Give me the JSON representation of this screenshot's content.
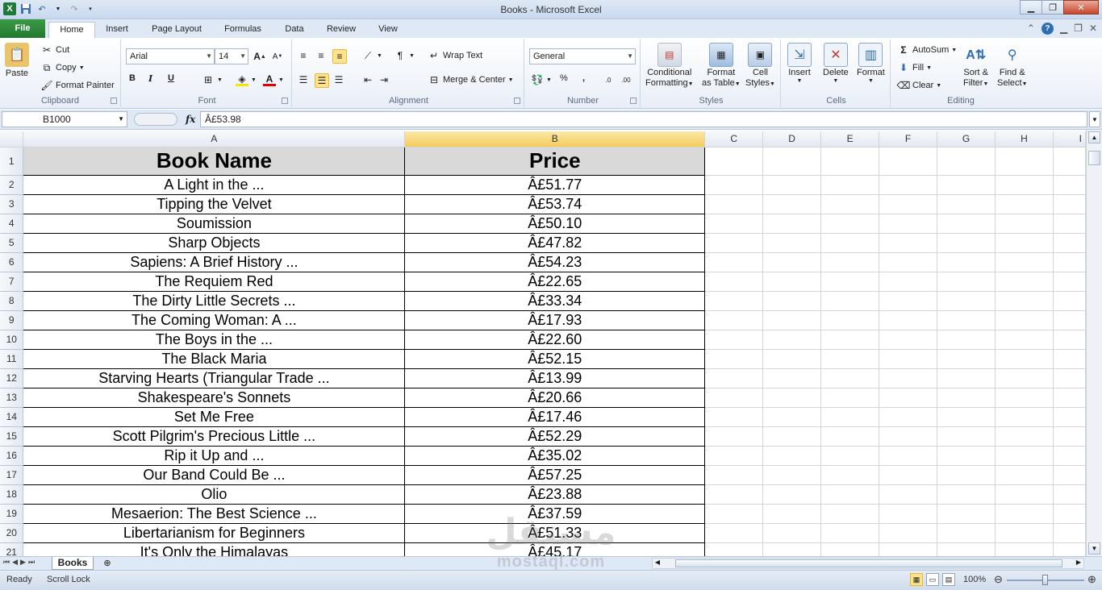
{
  "window": {
    "title": "Books - Microsoft Excel"
  },
  "ribbon": {
    "tabs": [
      "File",
      "Home",
      "Insert",
      "Page Layout",
      "Formulas",
      "Data",
      "Review",
      "View"
    ],
    "active_tab": "Home",
    "clipboard": {
      "paste": "Paste",
      "cut": "Cut",
      "copy": "Copy",
      "format_painter": "Format Painter",
      "label": "Clipboard"
    },
    "font": {
      "name": "Arial",
      "size": "14",
      "label": "Font",
      "bold": "B",
      "italic": "I",
      "underline": "U"
    },
    "alignment": {
      "wrap_text": "Wrap Text",
      "merge_center": "Merge & Center",
      "label": "Alignment"
    },
    "number": {
      "format": "General",
      "percent": "%",
      "comma": ",",
      "label": "Number"
    },
    "styles": {
      "conditional_formatting": [
        "Conditional",
        "Formatting"
      ],
      "format_as_table": [
        "Format",
        "as Table"
      ],
      "cell_styles": [
        "Cell",
        "Styles"
      ],
      "label": "Styles"
    },
    "cells": {
      "insert": "Insert",
      "delete": "Delete",
      "format": "Format",
      "label": "Cells"
    },
    "editing": {
      "autosum": "AutoSum",
      "fill": "Fill",
      "clear": "Clear",
      "sort_filter": [
        "Sort &",
        "Filter"
      ],
      "find_select": [
        "Find &",
        "Select"
      ],
      "label": "Editing"
    }
  },
  "formula_bar": {
    "name_box": "B1000",
    "fx": "fx",
    "formula": "Â£53.98"
  },
  "sheet": {
    "columns": [
      "A",
      "B",
      "C",
      "D",
      "E",
      "F",
      "G",
      "H",
      "I"
    ],
    "selected_column": "B",
    "header": {
      "book_name": "Book Name",
      "price": "Price"
    },
    "rows": [
      {
        "n": "2",
        "name": "A Light in the ...",
        "price": "Â£51.77"
      },
      {
        "n": "3",
        "name": "Tipping the Velvet",
        "price": "Â£53.74"
      },
      {
        "n": "4",
        "name": "Soumission",
        "price": "Â£50.10"
      },
      {
        "n": "5",
        "name": "Sharp Objects",
        "price": "Â£47.82"
      },
      {
        "n": "6",
        "name": "Sapiens: A Brief History ...",
        "price": "Â£54.23"
      },
      {
        "n": "7",
        "name": "The Requiem Red",
        "price": "Â£22.65"
      },
      {
        "n": "8",
        "name": "The Dirty Little Secrets ...",
        "price": "Â£33.34"
      },
      {
        "n": "9",
        "name": "The Coming Woman: A ...",
        "price": "Â£17.93"
      },
      {
        "n": "10",
        "name": "The Boys in the ...",
        "price": "Â£22.60"
      },
      {
        "n": "11",
        "name": "The Black Maria",
        "price": "Â£52.15"
      },
      {
        "n": "12",
        "name": "Starving Hearts (Triangular Trade ...",
        "price": "Â£13.99"
      },
      {
        "n": "13",
        "name": "Shakespeare's Sonnets",
        "price": "Â£20.66"
      },
      {
        "n": "14",
        "name": "Set Me Free",
        "price": "Â£17.46"
      },
      {
        "n": "15",
        "name": "Scott Pilgrim's Precious Little ...",
        "price": "Â£52.29"
      },
      {
        "n": "16",
        "name": "Rip it Up and ...",
        "price": "Â£35.02"
      },
      {
        "n": "17",
        "name": "Our Band Could Be ...",
        "price": "Â£57.25"
      },
      {
        "n": "18",
        "name": "Olio",
        "price": "Â£23.88"
      },
      {
        "n": "19",
        "name": "Mesaerion: The Best Science ...",
        "price": "Â£37.59"
      },
      {
        "n": "20",
        "name": "Libertarianism for Beginners",
        "price": "Â£51.33"
      },
      {
        "n": "21",
        "name": "It's Only the Himalayas",
        "price": "Â£45.17"
      }
    ]
  },
  "sheet_tabs": {
    "active": "Books"
  },
  "status": {
    "ready": "Ready",
    "scroll_lock": "Scroll Lock",
    "zoom": "100%"
  },
  "watermark": {
    "arabic": "مستقل",
    "latin": "mostaql.com"
  },
  "colors": {
    "header_fill": "#d9d9d9",
    "selected_col_header": "#f5cb5d",
    "file_tab": "#1f7a2e"
  }
}
